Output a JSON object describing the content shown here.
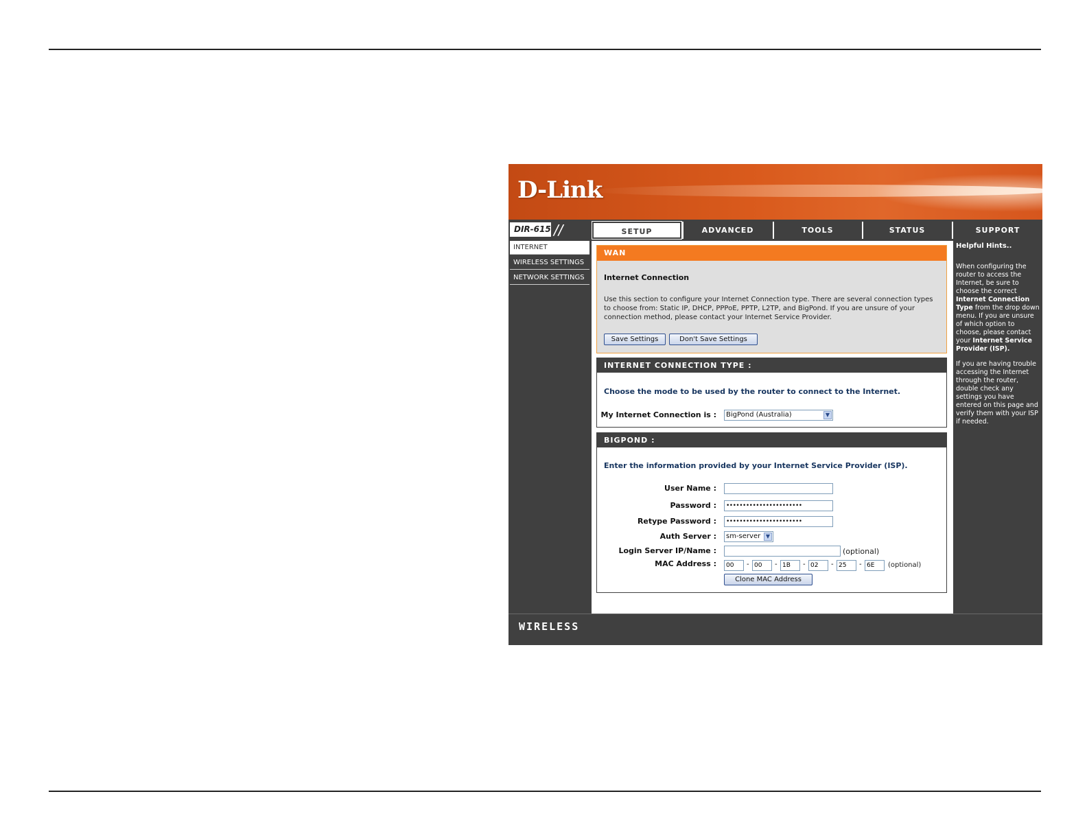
{
  "header": {
    "brand": "D-Link",
    "model": "DIR-615",
    "slashes": "//"
  },
  "tabs": [
    {
      "label": "SETUP",
      "active": true
    },
    {
      "label": "ADVANCED",
      "active": false
    },
    {
      "label": "TOOLS",
      "active": false
    },
    {
      "label": "STATUS",
      "active": false
    },
    {
      "label": "SUPPORT",
      "active": false
    }
  ],
  "sidebar": {
    "items": [
      {
        "label": "INTERNET",
        "active": true
      },
      {
        "label": "WIRELESS SETTINGS",
        "active": false
      },
      {
        "label": "NETWORK SETTINGS",
        "active": false
      }
    ]
  },
  "wan": {
    "title": "WAN",
    "subtitle": "Internet Connection",
    "description": "Use this section to configure your Internet Connection type. There are several connection types to choose from: Static IP, DHCP, PPPoE, PPTP, L2TP, and BigPond. If you are unsure of your connection method, please contact your Internet Service Provider.",
    "save_button": "Save Settings",
    "dont_save_button": "Don't Save Settings"
  },
  "connection_type": {
    "title": "INTERNET CONNECTION TYPE :",
    "instruction": "Choose the mode to be used by the router to connect to the Internet.",
    "label": "My Internet Connection is :",
    "selected": "BigPond (Australia)"
  },
  "bigpond": {
    "title": "BIGPOND :",
    "instruction": "Enter the information provided by your Internet Service Provider (ISP).",
    "username_label": "User Name :",
    "username_value": "",
    "password_label": "Password :",
    "password_value": "•••••••••••••••••••••••",
    "retype_label": "Retype Password :",
    "retype_value": "•••••••••••••••••••••••",
    "auth_label": "Auth Server :",
    "auth_value": "sm-server",
    "login_label": "Login Server IP/Name :",
    "login_value": "",
    "optional": "(optional)",
    "mac_label": "MAC Address :",
    "mac": [
      "00",
      "00",
      "1B",
      "02",
      "25",
      "6E"
    ],
    "mac_sep": "-",
    "clone_button": "Clone MAC Address"
  },
  "help": {
    "title": "Helpful Hints..",
    "p1_a": "When configuring the router to access the Internet, be sure to choose the correct ",
    "p1_b": "Internet Connection Type",
    "p1_c": " from the drop down menu. If you are unsure of which option to choose, please contact your ",
    "p1_d": "Internet Service Provider (ISP).",
    "p2": "If you are having trouble accessing the Internet through the router, double check any settings you have entered on this page and verify them with your ISP if needed."
  },
  "footer": {
    "label": "WIRELESS"
  }
}
